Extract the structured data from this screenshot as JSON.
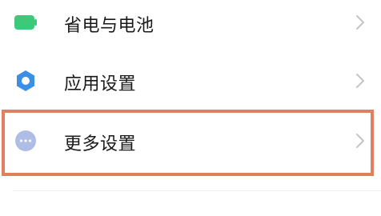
{
  "settings": {
    "items": [
      {
        "label": "省电与电池",
        "icon": "battery-icon",
        "color": "#3ec97a"
      },
      {
        "label": "应用设置",
        "icon": "gear-icon",
        "color": "#3a8fe6"
      },
      {
        "label": "更多设置",
        "icon": "more-dots-icon",
        "color": "#aebde6"
      }
    ]
  },
  "colors": {
    "highlight": "#e0805e",
    "chevron": "#c4c4c4",
    "text": "#1a1a1a"
  }
}
